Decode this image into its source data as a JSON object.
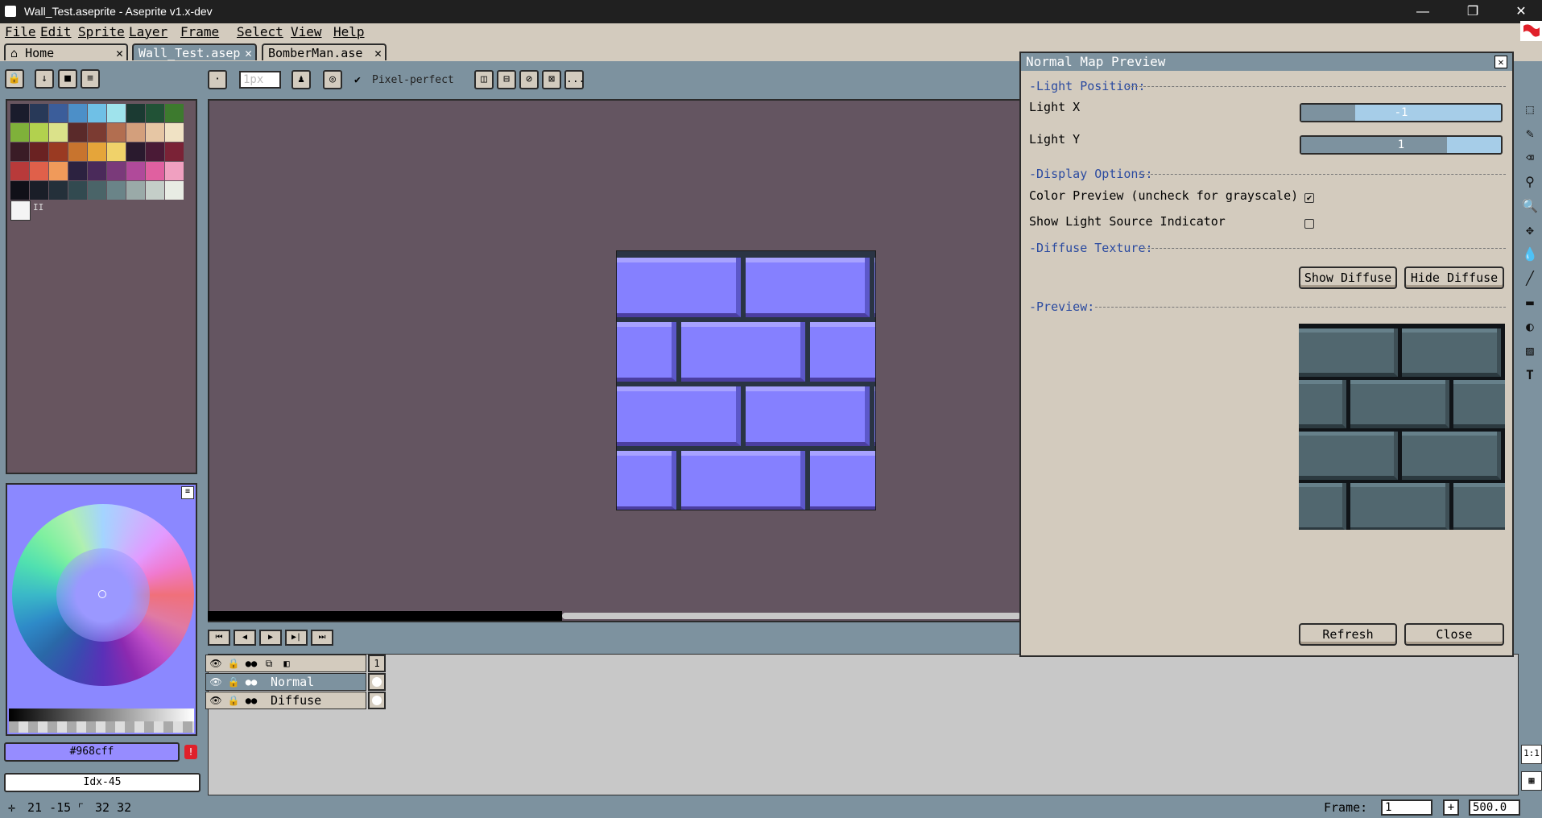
{
  "window": {
    "title": "Wall_Test.aseprite - Aseprite v1.x-dev",
    "minimize": "—",
    "maximize": "❐",
    "close": "✕"
  },
  "menu": [
    "File",
    "Edit",
    "Sprite",
    "Layer",
    "Frame",
    "Select",
    "View",
    "Help"
  ],
  "tabs": [
    {
      "label": "Home",
      "close": "✕"
    },
    {
      "label": "Wall_Test.asep",
      "close": "✕"
    },
    {
      "label": "BomberMan.ase",
      "close": "✕"
    }
  ],
  "toolbar": {
    "brush_size": "1px",
    "pixel_perfect_label": "Pixel-perfect",
    "more": "..."
  },
  "palette": {
    "colors": [
      [
        "#1a1c2c",
        "#283958",
        "#3b5d9a",
        "#4c8fc8",
        "#6fc0e6",
        "#9fe3ec",
        "#1b3a32",
        "#215236",
        "#3d7a2e"
      ],
      [
        "#7fb13a",
        "#b2d14e",
        "#dbe28a",
        "#5a2a2a",
        "#7b3b32",
        "#b26e50",
        "#d39f7c",
        "#e6c6a4",
        "#f0e2c4"
      ],
      [
        "#3a1c26",
        "#6a2222",
        "#9a3a22",
        "#c8742e",
        "#e5a53a",
        "#f0d26a",
        "#2a1a2e",
        "#4a1a36",
        "#7a2236"
      ],
      [
        "#b83a3a",
        "#e0604a",
        "#f09a5a",
        "#2c2240",
        "#4a2a5a",
        "#7a3a7a",
        "#b04a9a",
        "#e060a0",
        "#f0a0c0"
      ],
      [
        "#101018",
        "#1a1e28",
        "#24303a",
        "#324a50",
        "#4a6468",
        "#6a8488",
        "#9aaaa8",
        "#c4cec8",
        "#e8ece4"
      ]
    ],
    "fg_indicator": "II"
  },
  "color": {
    "hex": "#968cff",
    "index": "Idx-45",
    "warning": "!"
  },
  "timeline": {
    "buttons": [
      "⏮",
      "◀",
      "▶",
      "▶|",
      "⏭"
    ],
    "frame_header": "1",
    "layers": [
      {
        "name": "Normal",
        "selected": true
      },
      {
        "name": "Diffuse",
        "selected": false
      }
    ]
  },
  "status": {
    "cursor": "21 -15",
    "size": "32 32",
    "frame_label": "Frame:",
    "frame_value": "1",
    "zoom_value": "500.0"
  },
  "dialog": {
    "title": "Normal Map Preview",
    "close": "✕",
    "sections": {
      "light_position": "-Light Position:",
      "display_options": "-Display Options:",
      "diffuse_texture": "-Diffuse Texture:",
      "preview": "-Preview:"
    },
    "light_x": {
      "label": "Light X",
      "value": "-1",
      "fill": 0.27
    },
    "light_y": {
      "label": "Light Y",
      "value": "1",
      "fill": 0.73
    },
    "color_preview": {
      "label": "Color Preview (uncheck for grayscale)",
      "checked": true
    },
    "show_light_indicator": {
      "label": "Show Light Source Indicator",
      "checked": false
    },
    "show_diffuse": "Show Diffuse",
    "hide_diffuse": "Hide Diffuse",
    "refresh": "Refresh",
    "close_button": "Close"
  },
  "tools": [
    "marquee-icon",
    "pencil-icon",
    "eraser-icon",
    "eyedropper-icon",
    "zoom-icon",
    "move-icon",
    "fill-icon",
    "line-icon",
    "rect-icon",
    "contour-icon",
    "blur-icon",
    "text-icon"
  ],
  "bottom_tools": {
    "one_to_one": "1:1"
  }
}
